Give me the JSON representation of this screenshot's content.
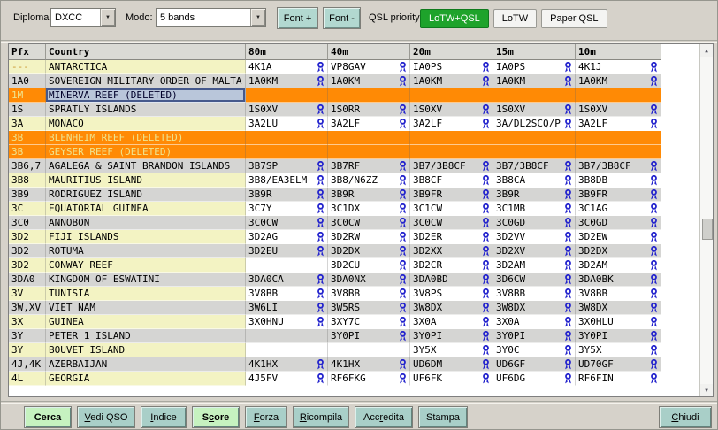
{
  "toolbar": {
    "diploma_label": "Diploma:",
    "diploma_value": "DXCC",
    "modo_label": "Modo:",
    "modo_value": "5 bands",
    "font_plus": "Font +",
    "font_minus": "Font -",
    "qsl_priority_label": "QSL priority:",
    "qsl_buttons": [
      {
        "label": "LoTW+QSL",
        "active": true
      },
      {
        "label": "LoTW",
        "active": false
      },
      {
        "label": "Paper QSL",
        "active": false
      }
    ]
  },
  "icons": {
    "combo_arrow": "▼",
    "scroll_up": "▲",
    "scroll_down": "▼",
    "lotw_icon_name": "lotw-award-ribbon"
  },
  "colors": {
    "qsl_active_green": "#1ea32b",
    "row_yellow": "#f3f3c3",
    "row_gray": "#d5d5d3",
    "deleted_orange": "#ff8a05",
    "deleted_text": "#efe48e",
    "lotw_icon_blue": "#2323cd",
    "button_green": "#c6f2c0",
    "button_teal": "#a9cfc8",
    "selected_cell_bg": "#b9c6da",
    "selected_cell_border": "#46598c"
  },
  "table": {
    "columns": [
      "Pfx",
      "Country",
      "80m",
      "40m",
      "20m",
      "15m",
      "10m"
    ],
    "rows": [
      {
        "pfx": "---",
        "country": "ANTARCTICA",
        "shade": "light",
        "pfx_gold": true,
        "selected": false,
        "bands": [
          {
            "call": "4K1A",
            "lotw": true
          },
          {
            "call": "VP8GAV",
            "lotw": true
          },
          {
            "call": "IA0PS",
            "lotw": true
          },
          {
            "call": "IA0PS",
            "lotw": true
          },
          {
            "call": "4K1J",
            "lotw": true
          }
        ]
      },
      {
        "pfx": "1A0",
        "country": "SOVEREIGN MILITARY ORDER OF MALTA",
        "shade": "dark",
        "selected": false,
        "bands": [
          {
            "call": "1A0KM",
            "lotw": true
          },
          {
            "call": "1A0KM",
            "lotw": true
          },
          {
            "call": "1A0KM",
            "lotw": true
          },
          {
            "call": "1A0KM",
            "lotw": true
          },
          {
            "call": "1A0KM",
            "lotw": true
          }
        ]
      },
      {
        "pfx": "1M",
        "country": "MINERVA REEF (DELETED)",
        "shade": "deleted",
        "selected": true,
        "bands": [
          null,
          null,
          null,
          null,
          null
        ]
      },
      {
        "pfx": "1S",
        "country": "SPRATLY ISLANDS",
        "shade": "dark",
        "selected": false,
        "bands": [
          {
            "call": "1S0XV",
            "lotw": true
          },
          {
            "call": "1S0RR",
            "lotw": true
          },
          {
            "call": "1S0XV",
            "lotw": true
          },
          {
            "call": "1S0XV",
            "lotw": true
          },
          {
            "call": "1S0XV",
            "lotw": true
          }
        ]
      },
      {
        "pfx": "3A",
        "country": "MONACO",
        "shade": "light",
        "selected": false,
        "bands": [
          {
            "call": "3A2LU",
            "lotw": true
          },
          {
            "call": "3A2LF",
            "lotw": true
          },
          {
            "call": "3A2LF",
            "lotw": true
          },
          {
            "call": "3A/DL2SCQ/P",
            "lotw": true
          },
          {
            "call": "3A2LF",
            "lotw": true
          }
        ]
      },
      {
        "pfx": "3B",
        "country": "BLENHEIM REEF (DELETED)",
        "shade": "deleted",
        "selected": false,
        "bands": [
          null,
          null,
          null,
          null,
          null
        ]
      },
      {
        "pfx": "3B",
        "country": "GEYSER REEF (DELETED)",
        "shade": "deleted",
        "selected": false,
        "bands": [
          null,
          null,
          null,
          null,
          null
        ]
      },
      {
        "pfx": "3B6,7",
        "country": "AGALEGA & SAINT BRANDON ISLANDS",
        "shade": "dark",
        "selected": false,
        "bands": [
          {
            "call": "3B7SP",
            "lotw": true
          },
          {
            "call": "3B7RF",
            "lotw": true
          },
          {
            "call": "3B7/3B8CF",
            "lotw": true
          },
          {
            "call": "3B7/3B8CF",
            "lotw": true
          },
          {
            "call": "3B7/3B8CF",
            "lotw": true
          }
        ]
      },
      {
        "pfx": "3B8",
        "country": "MAURITIUS ISLAND",
        "shade": "light",
        "selected": false,
        "bands": [
          {
            "call": "3B8/EA3ELM",
            "lotw": true
          },
          {
            "call": "3B8/N6ZZ",
            "lotw": true
          },
          {
            "call": "3B8CF",
            "lotw": true
          },
          {
            "call": "3B8CA",
            "lotw": true
          },
          {
            "call": "3B8DB",
            "lotw": true
          }
        ]
      },
      {
        "pfx": "3B9",
        "country": "RODRIGUEZ ISLAND",
        "shade": "dark",
        "selected": false,
        "bands": [
          {
            "call": "3B9R",
            "lotw": true
          },
          {
            "call": "3B9R",
            "lotw": true
          },
          {
            "call": "3B9FR",
            "lotw": true
          },
          {
            "call": "3B9R",
            "lotw": true
          },
          {
            "call": "3B9FR",
            "lotw": true
          }
        ]
      },
      {
        "pfx": "3C",
        "country": "EQUATORIAL GUINEA",
        "shade": "light",
        "selected": false,
        "bands": [
          {
            "call": "3C7Y",
            "lotw": true
          },
          {
            "call": "3C1DX",
            "lotw": true
          },
          {
            "call": "3C1CW",
            "lotw": true
          },
          {
            "call": "3C1MB",
            "lotw": true
          },
          {
            "call": "3C1AG",
            "lotw": true
          }
        ]
      },
      {
        "pfx": "3C0",
        "country": "ANNOBON",
        "shade": "dark",
        "selected": false,
        "bands": [
          {
            "call": "3C0CW",
            "lotw": true
          },
          {
            "call": "3C0CW",
            "lotw": true
          },
          {
            "call": "3C0CW",
            "lotw": true
          },
          {
            "call": "3C0GD",
            "lotw": true
          },
          {
            "call": "3C0GD",
            "lotw": true
          }
        ]
      },
      {
        "pfx": "3D2",
        "country": "FIJI ISLANDS",
        "shade": "light",
        "selected": false,
        "bands": [
          {
            "call": "3D2AG",
            "lotw": true
          },
          {
            "call": "3D2RW",
            "lotw": true
          },
          {
            "call": "3D2ER",
            "lotw": true
          },
          {
            "call": "3D2VV",
            "lotw": true
          },
          {
            "call": "3D2EW",
            "lotw": true
          }
        ]
      },
      {
        "pfx": "3D2",
        "country": "ROTUMA",
        "shade": "dark",
        "selected": false,
        "bands": [
          {
            "call": "3D2EU",
            "lotw": true
          },
          {
            "call": "3D2DX",
            "lotw": true
          },
          {
            "call": "3D2XX",
            "lotw": true
          },
          {
            "call": "3D2XV",
            "lotw": true
          },
          {
            "call": "3D2DX",
            "lotw": true
          }
        ]
      },
      {
        "pfx": "3D2",
        "country": "CONWAY REEF",
        "shade": "light",
        "selected": false,
        "bands": [
          null,
          {
            "call": "3D2CU",
            "lotw": true
          },
          {
            "call": "3D2CR",
            "lotw": true
          },
          {
            "call": "3D2AM",
            "lotw": true
          },
          {
            "call": "3D2AM",
            "lotw": true
          }
        ]
      },
      {
        "pfx": "3DA0",
        "country": "KINGDOM OF ESWATINI",
        "shade": "dark",
        "selected": false,
        "bands": [
          {
            "call": "3DA0CA",
            "lotw": true
          },
          {
            "call": "3DA0NX",
            "lotw": true
          },
          {
            "call": "3DA0BD",
            "lotw": true
          },
          {
            "call": "3D6CW",
            "lotw": true
          },
          {
            "call": "3DA0BK",
            "lotw": true
          }
        ]
      },
      {
        "pfx": "3V",
        "country": "TUNISIA",
        "shade": "light",
        "selected": false,
        "bands": [
          {
            "call": "3V8BB",
            "lotw": true
          },
          {
            "call": "3V8BB",
            "lotw": true
          },
          {
            "call": "3V8PS",
            "lotw": true
          },
          {
            "call": "3V8BB",
            "lotw": true
          },
          {
            "call": "3V8BB",
            "lotw": true
          }
        ]
      },
      {
        "pfx": "3W,XV",
        "country": "VIET NAM",
        "shade": "dark",
        "selected": false,
        "bands": [
          {
            "call": "3W6LI",
            "lotw": true
          },
          {
            "call": "3W5RS",
            "lotw": true
          },
          {
            "call": "3W8DX",
            "lotw": true
          },
          {
            "call": "3W8DX",
            "lotw": true
          },
          {
            "call": "3W8DX",
            "lotw": true
          }
        ]
      },
      {
        "pfx": "3X",
        "country": "GUINEA",
        "shade": "light",
        "selected": false,
        "bands": [
          {
            "call": "3X0HNU",
            "lotw": true
          },
          {
            "call": "3XY7C",
            "lotw": true
          },
          {
            "call": "3X0A",
            "lotw": true
          },
          {
            "call": "3X0A",
            "lotw": true
          },
          {
            "call": "3X0HLU",
            "lotw": true
          }
        ]
      },
      {
        "pfx": "3Y",
        "country": "PETER 1 ISLAND",
        "shade": "dark",
        "selected": false,
        "bands": [
          null,
          {
            "call": "3Y0PI",
            "lotw": true
          },
          {
            "call": "3Y0PI",
            "lotw": true
          },
          {
            "call": "3Y0PI",
            "lotw": true
          },
          {
            "call": "3Y0PI",
            "lotw": true
          }
        ]
      },
      {
        "pfx": "3Y",
        "country": "BOUVET ISLAND",
        "shade": "light",
        "selected": false,
        "bands": [
          null,
          null,
          {
            "call": "3Y5X",
            "lotw": true
          },
          {
            "call": "3Y0C",
            "lotw": true
          },
          {
            "call": "3Y5X",
            "lotw": true
          }
        ]
      },
      {
        "pfx": "4J,4K",
        "country": "AZERBAIJAN",
        "shade": "dark",
        "selected": false,
        "bands": [
          {
            "call": "4K1HX",
            "lotw": true
          },
          {
            "call": "4K1HX",
            "lotw": true
          },
          {
            "call": "UD6DM",
            "lotw": true
          },
          {
            "call": "UD6GF",
            "lotw": true
          },
          {
            "call": "UD70GF",
            "lotw": true
          }
        ]
      },
      {
        "pfx": "4L",
        "country": "GEORGIA",
        "shade": "light",
        "selected": false,
        "bands": [
          {
            "call": "4J5FV",
            "lotw": true
          },
          {
            "call": "RF6FKG",
            "lotw": true
          },
          {
            "call": "UF6FK",
            "lotw": true
          },
          {
            "call": "UF6DG",
            "lotw": true
          },
          {
            "call": "RF6FIN",
            "lotw": true
          }
        ]
      }
    ]
  },
  "bottom_buttons": {
    "left": [
      {
        "label": "Cerca",
        "accel": -1,
        "variant": "green"
      },
      {
        "label": "Vedi QSO",
        "accel": 0,
        "variant": "teal"
      },
      {
        "label": "Indice",
        "accel": 0,
        "variant": "teal"
      },
      {
        "label": "Score",
        "accel": 1,
        "variant": "green"
      },
      {
        "label": "Forza",
        "accel": 0,
        "variant": "teal"
      },
      {
        "label": "Ricompila",
        "accel": 0,
        "variant": "teal"
      },
      {
        "label": "Accredita",
        "accel": 3,
        "variant": "teal"
      },
      {
        "label": "Stampa",
        "accel": -1,
        "variant": "teal"
      }
    ],
    "right": {
      "label": "Chiudi",
      "accel": 0,
      "variant": "teal"
    }
  }
}
